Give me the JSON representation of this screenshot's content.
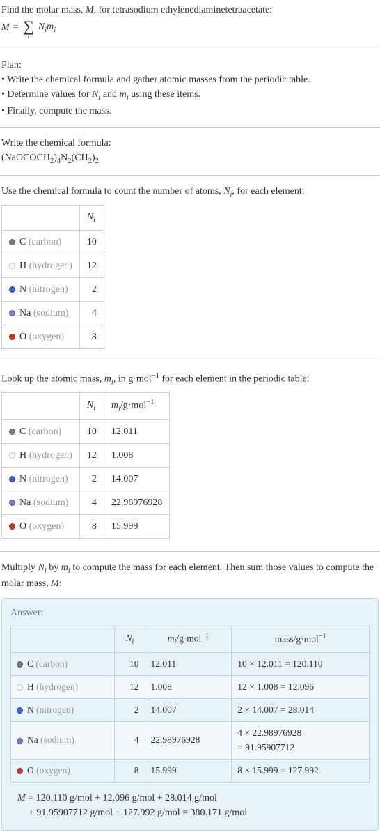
{
  "intro": {
    "line1_a": "Find the molar mass, ",
    "line1_b": "M",
    "line1_c": ", for tetrasodium ethylenediaminetetraacetate:",
    "eq_lhs": "M",
    "eq_eq": " = ",
    "eq_sigma": "∑",
    "eq_under": "i",
    "eq_rhs_a": "N",
    "eq_rhs_b": "i",
    "eq_rhs_c": "m",
    "eq_rhs_d": "i"
  },
  "plan": {
    "heading": "Plan:",
    "b1_a": "• Write the chemical formula and gather atomic masses from the periodic table.",
    "b2_a": "• Determine values for ",
    "b2_b": "N",
    "b2_c": "i",
    "b2_d": " and ",
    "b2_e": "m",
    "b2_f": "i",
    "b2_g": " using these items.",
    "b3_a": "• Finally, compute the mass."
  },
  "chem": {
    "heading": "Write the chemical formula:",
    "p1": "(NaOCOCH",
    "p2": "2",
    "p3": ")",
    "p4": "4",
    "p5": "N",
    "p6": "2",
    "p7": "(CH",
    "p8": "2",
    "p9": ")",
    "p10": "2"
  },
  "count": {
    "heading_a": "Use the chemical formula to count the number of atoms, ",
    "heading_b": "N",
    "heading_c": "i",
    "heading_d": ", for each element:",
    "head_ni_a": "N",
    "head_ni_b": "i",
    "rows": [
      {
        "sym": "C",
        "name": "(carbon)",
        "dot": "dot-c",
        "ni": "10"
      },
      {
        "sym": "H",
        "name": "(hydrogen)",
        "dot": "dot-h",
        "ni": "12"
      },
      {
        "sym": "N",
        "name": "(nitrogen)",
        "dot": "dot-n",
        "ni": "2"
      },
      {
        "sym": "Na",
        "name": "(sodium)",
        "dot": "dot-na",
        "ni": "4"
      },
      {
        "sym": "O",
        "name": "(oxygen)",
        "dot": "dot-o",
        "ni": "8"
      }
    ]
  },
  "mass": {
    "heading_a": "Look up the atomic mass, ",
    "heading_b": "m",
    "heading_c": "i",
    "heading_d": ", in g·mol",
    "heading_e": "−1",
    "heading_f": " for each element in the periodic table:",
    "head_mi_a": "m",
    "head_mi_b": "i",
    "head_mi_c": "/g·mol",
    "head_mi_d": "−1",
    "rows": [
      {
        "mi": "12.011"
      },
      {
        "mi": "1.008"
      },
      {
        "mi": "14.007"
      },
      {
        "mi": "22.98976928"
      },
      {
        "mi": "15.999"
      }
    ]
  },
  "multiply": {
    "a": "Multiply ",
    "b": "N",
    "c": "i",
    "d": " by ",
    "e": "m",
    "f": "i",
    "g": " to compute the mass for each element. Then sum those values to compute the molar mass, ",
    "h": "M",
    "i": ":"
  },
  "answer": {
    "label": "Answer:",
    "head_mass_a": "mass/g·mol",
    "head_mass_b": "−1",
    "rows": [
      {
        "calc": "10 × 12.011 = 120.110"
      },
      {
        "calc": "12 × 1.008 = 12.096"
      },
      {
        "calc": "2 × 14.007 = 28.014"
      },
      {
        "calc_a": "4 × 22.98976928",
        "calc_b": "= 91.95907712"
      },
      {
        "calc": "8 × 15.999 = 127.992"
      }
    ],
    "final_a": "M",
    "final_b": " = 120.110 g/mol + 12.096 g/mol + 28.014 g/mol",
    "final_c": "+ 91.95907712 g/mol + 127.992 g/mol = 380.171 g/mol"
  },
  "chart_data": {
    "type": "table",
    "title": "Molar mass computation for tetrasodium ethylenediaminetetraacetate",
    "columns": [
      "element",
      "N_i",
      "m_i (g/mol)",
      "mass (g/mol)"
    ],
    "rows": [
      {
        "element": "C (carbon)",
        "N_i": 10,
        "m_i": 12.011,
        "mass": 120.11
      },
      {
        "element": "H (hydrogen)",
        "N_i": 12,
        "m_i": 1.008,
        "mass": 12.096
      },
      {
        "element": "N (nitrogen)",
        "N_i": 2,
        "m_i": 14.007,
        "mass": 28.014
      },
      {
        "element": "Na (sodium)",
        "N_i": 4,
        "m_i": 22.98976928,
        "mass": 91.95907712
      },
      {
        "element": "O (oxygen)",
        "N_i": 8,
        "m_i": 15.999,
        "mass": 127.992
      }
    ],
    "molar_mass_total_g_per_mol": 380.171
  }
}
